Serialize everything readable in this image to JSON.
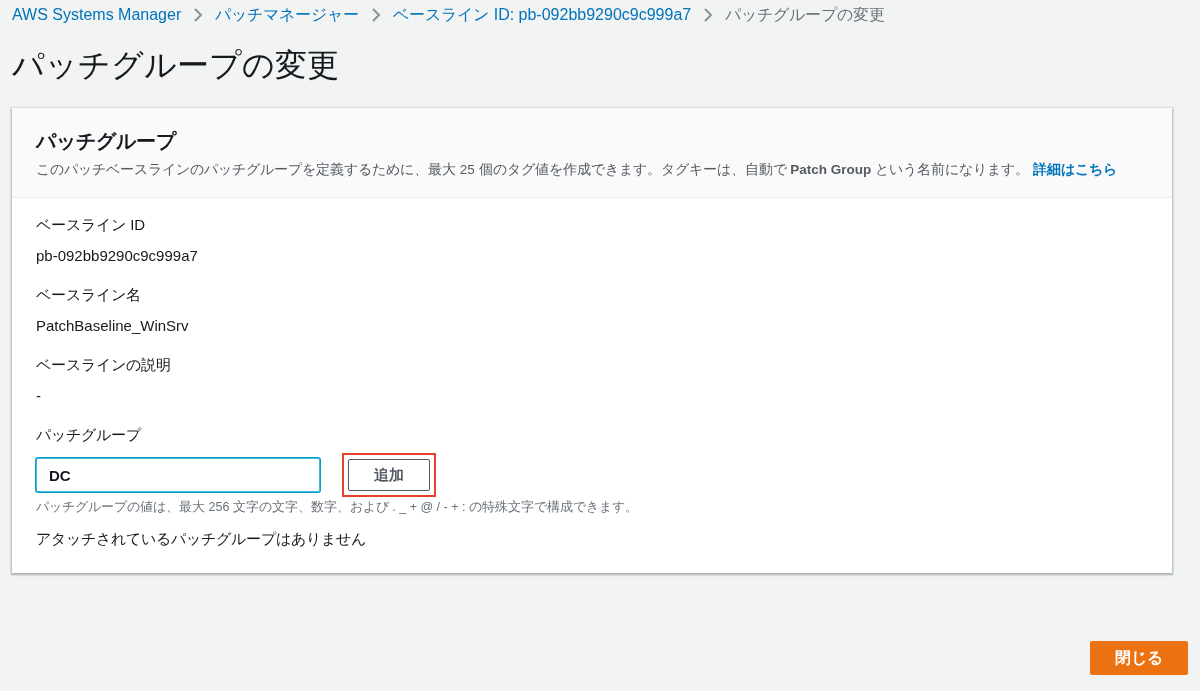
{
  "breadcrumbs": [
    {
      "label": "AWS Systems Manager",
      "link": true
    },
    {
      "label": "パッチマネージャー",
      "link": true
    },
    {
      "label": "ベースライン ID: pb-092bb9290c9c999a7",
      "link": true
    },
    {
      "label": "パッチグループの変更",
      "link": false
    }
  ],
  "page_title": "パッチグループの変更",
  "panel": {
    "title": "パッチグループ",
    "description": "このパッチベースラインのパッチグループを定義するために、最大 25 個のタグ値を作成できます。タグキーは、自動で **Patch Group** という名前になります。",
    "info_link": "詳細はこちら",
    "fields": [
      {
        "label": "ベースライン ID",
        "value": "pb-092bb9290c9c999a7"
      },
      {
        "label": "ベースライン名",
        "value": "PatchBaseline_WinSrv"
      },
      {
        "label": "ベースラインの説明",
        "value": "-"
      }
    ],
    "patch_group": {
      "label": "パッチグループ",
      "value": "DC",
      "add_button": "追加",
      "highlighted": true,
      "hint": "パッチグループの値は、最大 256 文字の文字、数字、および . _ + @ / - + : の特殊文字で構成できます。",
      "empty_message": "アタッチされているパッチグループはありません"
    }
  },
  "close_button": "閉じる"
}
